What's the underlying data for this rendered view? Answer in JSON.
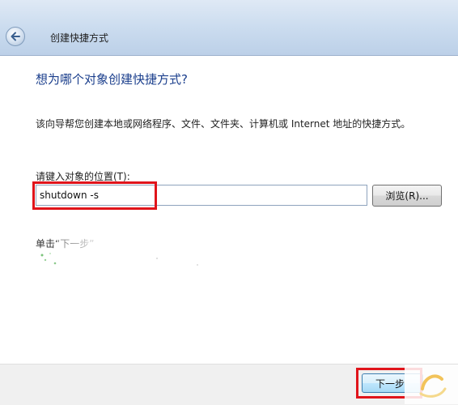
{
  "window": {
    "title": "创建快捷方式"
  },
  "main": {
    "heading": "想为哪个对象创建快捷方式?",
    "description": "该向导帮您创建本地或网络程序、文件、文件夹、计算机或 Internet 地址的快捷方式。",
    "location_label": "请键入对象的位置(T):",
    "location_value": "shutdown -s",
    "browse_label": "浏览(R)...",
    "hint_partial": "单击“下一步”"
  },
  "footer": {
    "next_label": "下一步"
  },
  "colors": {
    "heading": "#1a3e8c",
    "highlight": "#e0141b",
    "titlebar": "#cbdcef"
  },
  "icons": {
    "back": "back-arrow-icon"
  }
}
